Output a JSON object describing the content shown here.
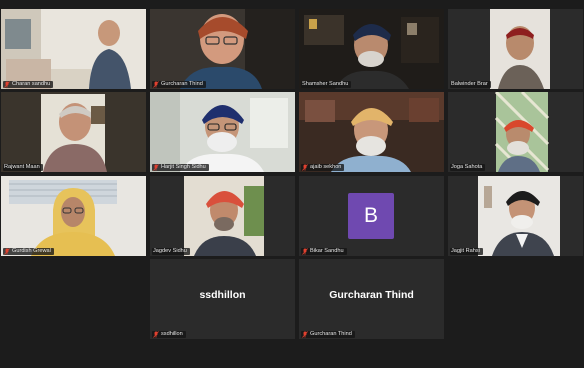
{
  "window": {
    "background": "#1c1c1c",
    "active_speaker_color": "#c9d23a"
  },
  "tiles": [
    {
      "name": "Charan sandhu",
      "type": "video",
      "active": false
    },
    {
      "name": "Gurcharan Thind",
      "type": "video",
      "active": false
    },
    {
      "name": "Shamsher Sandhu",
      "type": "video",
      "active": false
    },
    {
      "name": "Balwinder Brar",
      "type": "video",
      "active": false
    },
    {
      "name": "Rajwant Maan",
      "type": "video",
      "active": true
    },
    {
      "name": "Harjit Singh Sidhu",
      "type": "video",
      "active": false
    },
    {
      "name": "ajaib sekhon",
      "type": "video",
      "active": false
    },
    {
      "name": "Joga Sahota",
      "type": "video",
      "active": false
    },
    {
      "name": "Gurdish Grewal",
      "type": "video",
      "active": false
    },
    {
      "name": "Jagdev Sidhu",
      "type": "video",
      "active": false
    },
    {
      "name": "Bikar Sandhu",
      "type": "avatar",
      "initial": "B",
      "avatar_color": "#6f49b0"
    },
    {
      "name": "Jagjit Rahsi",
      "type": "video",
      "active": false
    },
    {
      "name": "ssdhillon",
      "type": "name-only",
      "display": "ssdhillon"
    },
    {
      "name": "Gurcharan Thind",
      "type": "name-only",
      "display": "Gurcharan Thind"
    }
  ],
  "icons": {
    "mute": "muted-microphone-icon",
    "mute_color": "#e0412f"
  }
}
